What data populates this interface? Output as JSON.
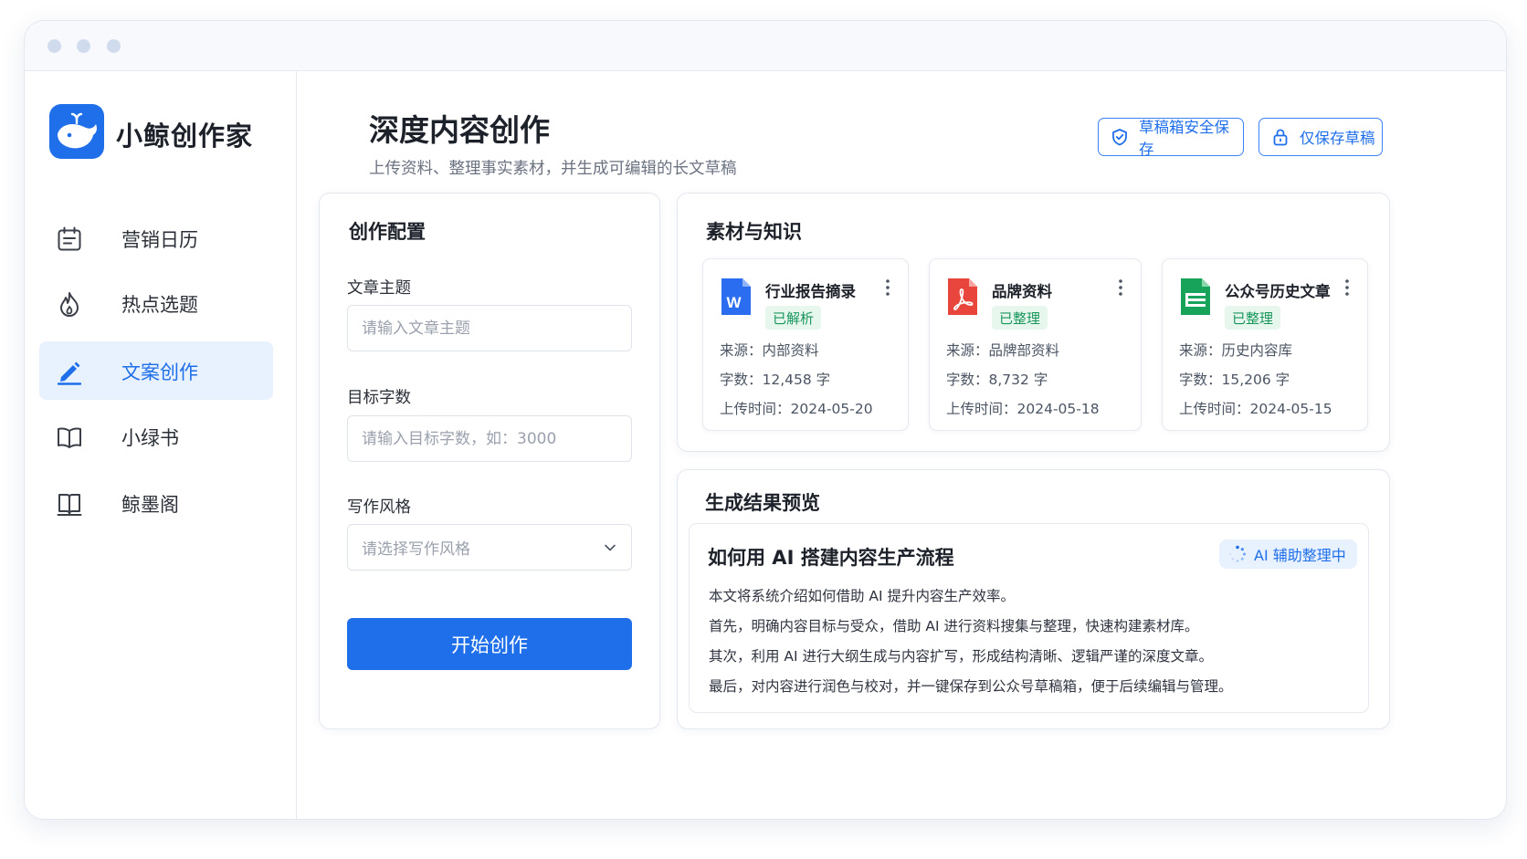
{
  "app": {
    "brand": "小鲸创作家"
  },
  "sidebar": {
    "items": [
      {
        "label": "营销日历",
        "icon": "calendar-icon",
        "active": false
      },
      {
        "label": "热点选题",
        "icon": "flame-icon",
        "active": false
      },
      {
        "label": "文案创作",
        "icon": "pencil-icon",
        "active": true
      },
      {
        "label": "小绿书",
        "icon": "open-book-icon",
        "active": false
      },
      {
        "label": "鲸墨阁",
        "icon": "book-icon",
        "active": false
      }
    ]
  },
  "header": {
    "title": "深度内容创作",
    "subtitle": "上传资料、整理事实素材，并生成可编辑的长文草稿",
    "buttons": [
      {
        "label": "草稿箱安全保存",
        "icon": "shield-check-icon"
      },
      {
        "label": "仅保存草稿",
        "icon": "lock-icon"
      }
    ]
  },
  "config": {
    "title": "创作配置",
    "topic": {
      "label": "文章主题",
      "placeholder": "请输入文章主题",
      "value": ""
    },
    "word_count": {
      "label": "目标字数",
      "placeholder": "请输入目标字数，如：3000",
      "value": ""
    },
    "style": {
      "label": "写作风格",
      "placeholder": "请选择写作风格"
    },
    "start_label": "开始创作"
  },
  "materials": {
    "title": "素材与知识",
    "items": [
      {
        "name": "行业报告摘录",
        "status": "已解析",
        "icon": "word-doc-icon",
        "source_label": "来源：",
        "source": "内部资料",
        "count_label": "字数：",
        "count": "12,458 字",
        "date_label": "上传时间：",
        "date": "2024-05-20"
      },
      {
        "name": "品牌资料",
        "status": "已整理",
        "icon": "pdf-doc-icon",
        "source_label": "来源：",
        "source": "品牌部资料",
        "count_label": "字数：",
        "count": "8,732 字",
        "date_label": "上传时间：",
        "date": "2024-05-18"
      },
      {
        "name": "公众号历史文章",
        "status": "已整理",
        "icon": "sheet-doc-icon",
        "source_label": "来源：",
        "source": "历史内容库",
        "count_label": "字数：",
        "count": "15,206 字",
        "date_label": "上传时间：",
        "date": "2024-05-15"
      }
    ]
  },
  "preview": {
    "title": "生成结果预览",
    "doc_title": "如何用 AI 搭建内容生产流程",
    "badge": "AI 辅助整理中",
    "paragraphs": [
      "本文将系统介绍如何借助 AI 提升内容生产效率。",
      "首先，明确内容目标与受众，借助 AI 进行资料搜集与整理，快速构建素材库。",
      "其次，利用 AI 进行大纲生成与内容扩写，形成结构清晰、逻辑严谨的深度文章。",
      "最后，对内容进行润色与校对，并一键保存到公众号草稿箱，便于后续编辑与管理。"
    ]
  },
  "colors": {
    "accent": "#1f6fea",
    "success": "#17965b",
    "success_bg": "#e8f7ee",
    "word": "#2b6df0",
    "pdf": "#e8453c",
    "sheet": "#17a35a"
  }
}
